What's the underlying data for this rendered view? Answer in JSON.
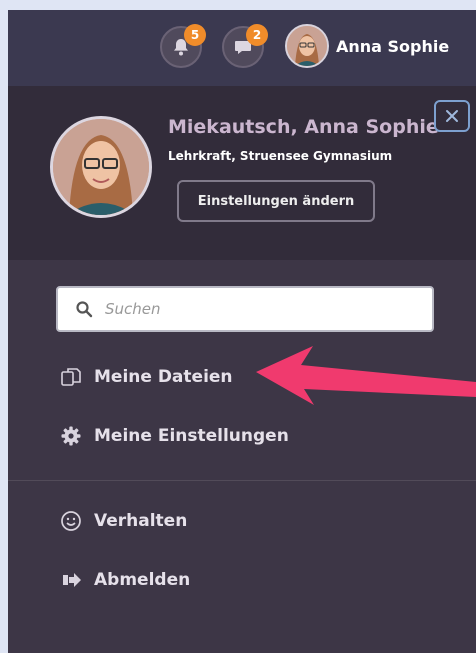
{
  "header": {
    "notifications": {
      "count": "5"
    },
    "messages": {
      "count": "2"
    },
    "user_name": "Anna Sophie"
  },
  "profile": {
    "full_name": "Miekautsch, Anna Sophie",
    "role": "Lehrkraft, Struensee Gymnasium",
    "settings_button": "Einstellungen ändern"
  },
  "search": {
    "placeholder": "Suchen"
  },
  "menu": {
    "items": [
      {
        "label": "Meine Dateien",
        "icon": "files-icon"
      },
      {
        "label": "Meine Einstellungen",
        "icon": "gear-icon"
      },
      {
        "label": "Verhalten",
        "icon": "smiley-icon"
      },
      {
        "label": "Abmelden",
        "icon": "logout-icon"
      }
    ]
  },
  "colors": {
    "badge": "#f08c2a",
    "arrow": "#f03a6e",
    "panel": "#3d3646",
    "profile_name": "#cbb6cf"
  }
}
